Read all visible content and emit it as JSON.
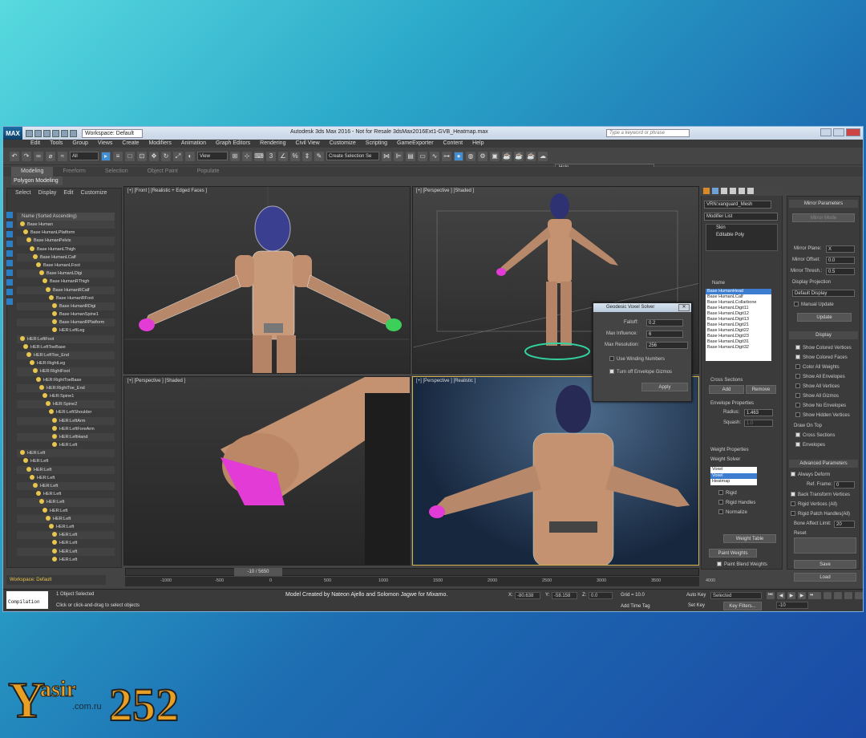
{
  "app": {
    "logo": "MAX",
    "workspace": "Workspace: Default",
    "title": "Autodesk 3ds Max 2016 - Not for Resale    3dsMax2016Ext1-GVB_Heatmap.max",
    "search_placeholder": "Type a keyword or phrase"
  },
  "menu": [
    "Edit",
    "Tools",
    "Group",
    "Views",
    "Create",
    "Modifiers",
    "Animation",
    "Graph Editors",
    "Rendering",
    "Civil View",
    "Customize",
    "Scripting",
    "GameExporter",
    "Content",
    "Help"
  ],
  "toolbar": {
    "filter": "All",
    "view": "View",
    "selection_set": "Create Selection Se",
    "help_tooltip": "Help"
  },
  "ribbon": {
    "tabs": [
      "Modeling",
      "Freeform",
      "Selection",
      "Object Paint",
      "Populate"
    ],
    "sub": "Polygon Modeling"
  },
  "scene_explorer": {
    "menu": [
      "Select",
      "Display",
      "Edit",
      "Customize"
    ],
    "header": "Name (Sorted Ascending)",
    "rows": [
      "Base Human",
      "Base HumanLPlatform",
      "Base HumanPelvis",
      "Base HumanLThigh",
      "Base HumanLCalf",
      "Base HumanLFoot",
      "Base HumanLDigi",
      "Base HumanRThigh",
      "Base HumanRCalf",
      "Base HumanRFoot",
      "Base HumanRDigi",
      "Base HumanSpine1",
      "Base HumanRPlatform",
      "HER:LeftLeg",
      "HER:LeftFoot",
      "HER:LeftToeBase",
      "HER:LeftToe_End",
      "HER:RightLeg",
      "HER:RightFoot",
      "HER:RightToeBase",
      "HER:RightToe_End",
      "HER:Spine1",
      "HER:Spine2",
      "HER:LeftShoulder",
      "HER:LeftArm",
      "HER:LeftForeArm",
      "HER:LeftHand",
      "HER:Left",
      "HER:Left",
      "HER:Left",
      "HER:Left",
      "HER:Left",
      "HER:Left",
      "HER:Left",
      "HER:Left",
      "HER:Left",
      "HER:Left",
      "HER:Left",
      "HER:Left",
      "HER:Left",
      "HER:Left",
      "HER:Left"
    ],
    "workspace_footer": "Workspace: Default"
  },
  "viewports": {
    "top_left": "[+] [Front ] [Realistic + Edged Faces ]",
    "top_right": "[+] [Perspective ] [Shaded ]",
    "bottom_left": "[+] [Perspective ] [Shaded ]",
    "bottom_right": "[+] [Perspective ] [Realistic ]"
  },
  "dialog": {
    "title": "Geodesic Voxel Solver",
    "falloff_label": "Falloff:",
    "falloff": "0.2",
    "max_influence_label": "Max Influence:",
    "max_influence": "6",
    "max_resolution_label": "Max Resolution:",
    "max_resolution": "256",
    "winding": "Use Winding Numbers",
    "gizmos": "Turn off Envelope Gizmos",
    "apply": "Apply"
  },
  "command_panel": {
    "object_name": "VRN:vanguard_Mesh",
    "modifier_list": "Modifier List",
    "stack": [
      "Skin",
      "Editable Poly"
    ],
    "name_header": "Name",
    "bones": [
      "Base HumanHead",
      "Base HumanLCalf",
      "Base HumanLCollarbone",
      "Base HumanLDigit11",
      "Base HumanLDigit12",
      "Base HumanLDigit13",
      "Base HumanLDigit21",
      "Base HumanLDigit22",
      "Base HumanLDigit23",
      "Base HumanLDigit31",
      "Base HumanLDigit32"
    ],
    "cross_sections": "Cross Sections",
    "add": "Add",
    "remove": "Remove",
    "envelope_properties": "Envelope Properties",
    "radius_label": "Radius:",
    "radius": "1.463",
    "squash_label": "Squash:",
    "squash": "1.0",
    "weight_properties": "Weight Properties",
    "weight_solver": "Weight Solver",
    "solver": "Voxel",
    "solver_options": [
      "Voxel",
      "Heatmap"
    ],
    "rigid": "Rigid",
    "rigid_handles": "Rigid Handles",
    "normalize": "Normalize",
    "weight_table": "Weight Table",
    "paint_weights": "Paint Weights",
    "paint_blend": "Paint Blend Weights"
  },
  "right_panel": {
    "mirror_parameters": "Mirror Parameters",
    "mirror_mode": "Mirror Mode",
    "mirror_plane_label": "Mirror Plane:",
    "mirror_plane": "X",
    "mirror_offset_label": "Mirror Offset:",
    "mirror_offset": "0.0",
    "mirror_thresh_label": "Mirror Thresh.:",
    "mirror_thresh": "0.5",
    "display_projection": "Display Projection",
    "default_display": "Default Display",
    "manual_update": "Manual Update",
    "update": "Update",
    "display": "Display",
    "display_checks": [
      "Show Colored Vertices",
      "Show Colored Faces",
      "Color All Weights",
      "Show All Envelopes",
      "Show All Vertices",
      "Show All Gizmos",
      "Show No Envelopes",
      "Show Hidden Vertices"
    ],
    "draw_on_top": "Draw On Top",
    "draw_checks": [
      "Cross Sections",
      "Envelopes"
    ],
    "advanced_parameters": "Advanced Parameters",
    "always_deform": "Always Deform",
    "ref_frame_label": "Ref. Frame:",
    "ref_frame": "0",
    "adv_checks": [
      "Back Transform Vertices",
      "Rigid Vertices (All)",
      "Rigid Patch Handles(All)"
    ],
    "bone_affect_label": "Bone Affect Limit:",
    "bone_affect": "20",
    "reset": "Reset",
    "save": "Save",
    "load": "Load"
  },
  "timeline": {
    "slider": "-10 / 5650",
    "ticks": [
      "-1000",
      "-500",
      "0",
      "500",
      "1000",
      "1500",
      "2000",
      "2500",
      "3000",
      "3500",
      "4000"
    ]
  },
  "status": {
    "compilation": "Compilation",
    "selected": "1 Object Selected",
    "prompt": "Click or click-and-drag to select objects",
    "credit": "Model Created by Nateon Ajello and Solomon Jagwe for Mixamo.",
    "x": "-80.638",
    "y": "-58.158",
    "z": "0.0",
    "grid": "Grid = 10.0",
    "add_time_tag": "Add Time Tag",
    "auto_key": "Auto Key",
    "set_key": "Set Key",
    "key_mode": "Selected",
    "key_filters": "Key Filters...",
    "frame": "-10"
  },
  "watermark": {
    "name": "Yasir",
    "number": "252",
    "domain": ".com.ru"
  }
}
